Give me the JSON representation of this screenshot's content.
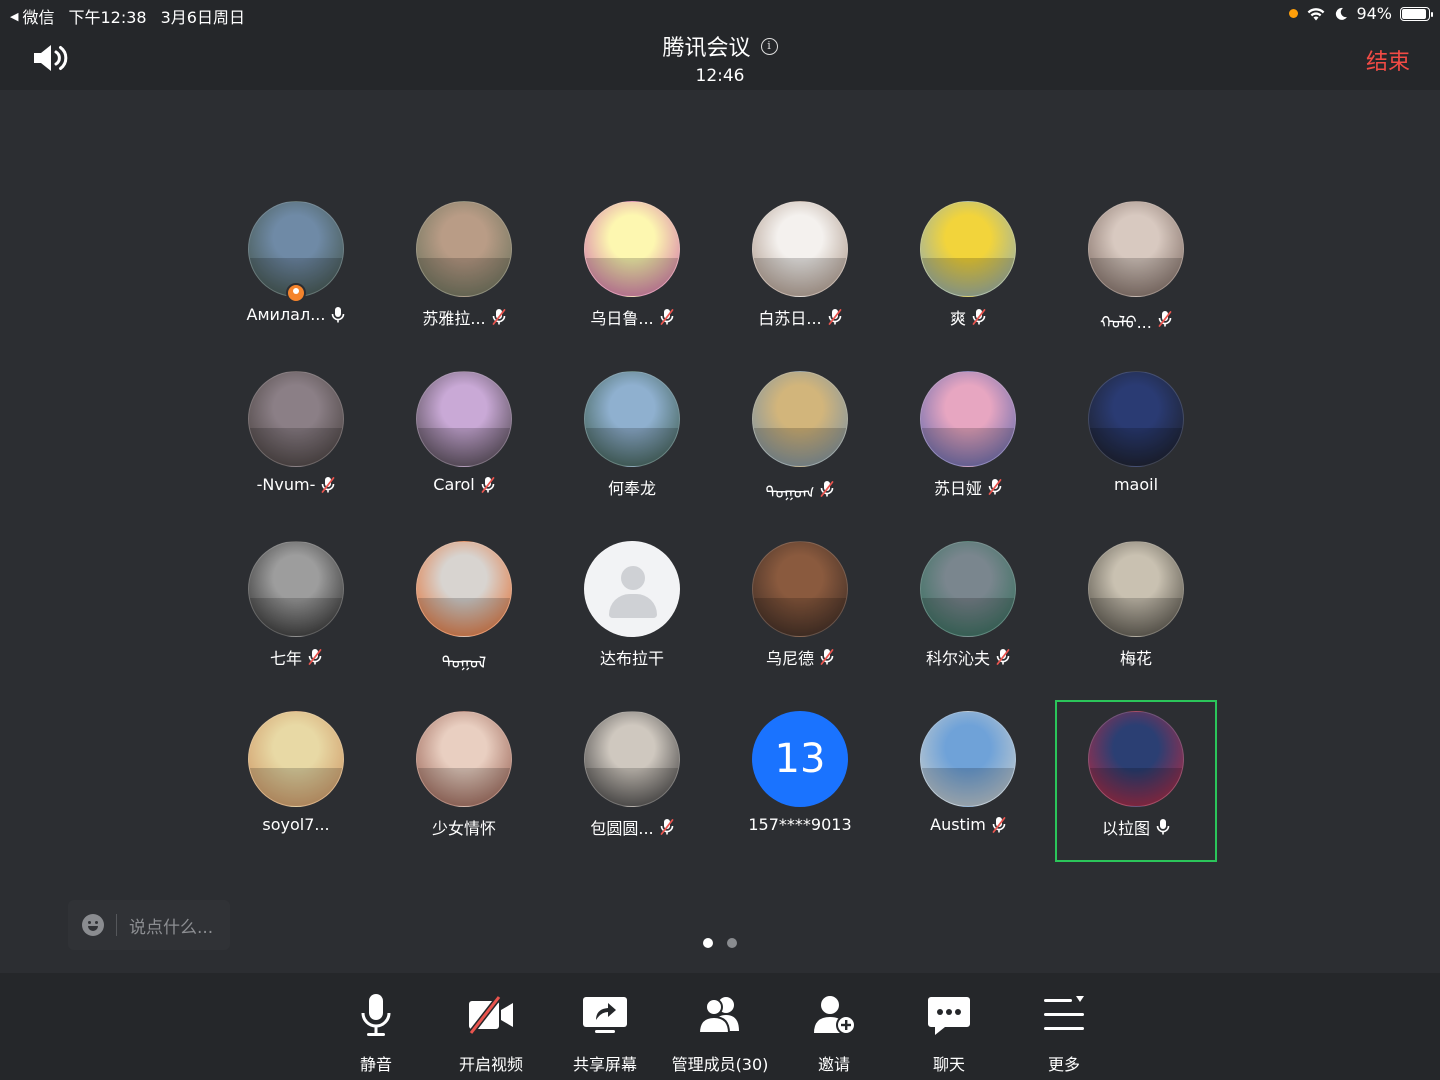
{
  "status_bar": {
    "back_app": "微信",
    "time": "下午12:38",
    "date": "3月6日周日",
    "battery": "94%",
    "battery_level": 0.94
  },
  "header": {
    "title": "腾讯会议",
    "clock": "12:46",
    "end_label": "结束"
  },
  "participants": [
    {
      "name": "Амилал...",
      "mic": "on",
      "host": true,
      "avatar": "photo",
      "colors": [
        "#6f8aa6",
        "#3b4a3a"
      ]
    },
    {
      "name": "苏雅拉...",
      "mic": "muted",
      "avatar": "photo",
      "colors": [
        "#b99c86",
        "#5d6b55"
      ]
    },
    {
      "name": "乌日鲁...",
      "mic": "muted",
      "avatar": "photo",
      "colors": [
        "#fdf7b0",
        "#c95aa8"
      ]
    },
    {
      "name": "白苏日...",
      "mic": "muted",
      "avatar": "photo",
      "colors": [
        "#f4f1ee",
        "#a08878"
      ]
    },
    {
      "name": "爽",
      "mic": "muted",
      "avatar": "photo",
      "colors": [
        "#f2d43b",
        "#7fa6c9"
      ]
    },
    {
      "name": "ᠬᠣᠯᠣ...",
      "mic": "muted",
      "avatar": "photo",
      "colors": [
        "#d8c9c0",
        "#6e5a52"
      ]
    },
    {
      "name": "-Nvum-",
      "mic": "muted",
      "avatar": "photo",
      "colors": [
        "#8b7f86",
        "#3c3532"
      ]
    },
    {
      "name": "Carol",
      "mic": "muted",
      "avatar": "photo",
      "colors": [
        "#c9a9d6",
        "#3a3538"
      ]
    },
    {
      "name": "何奉龙",
      "mic": "none",
      "avatar": "photo",
      "colors": [
        "#8fb0cf",
        "#2f4d39"
      ]
    },
    {
      "name": "ᠲᠣᠭᠣᠭ",
      "mic": "muted",
      "avatar": "photo",
      "colors": [
        "#d2b57b",
        "#6a8bab"
      ]
    },
    {
      "name": "苏日娅",
      "mic": "muted",
      "avatar": "photo",
      "colors": [
        "#e7a6c1",
        "#4a5ea8"
      ]
    },
    {
      "name": "maoil",
      "mic": "none",
      "avatar": "photo",
      "colors": [
        "#2a3b73",
        "#1a1a1a"
      ]
    },
    {
      "name": "七年",
      "mic": "muted",
      "avatar": "photo",
      "colors": [
        "#9d9d9d",
        "#1c1c1c"
      ]
    },
    {
      "name": "ᠲᠣᠭᠣᠯ",
      "mic": "none",
      "avatar": "photo",
      "colors": [
        "#d8d4d0",
        "#e3611d"
      ]
    },
    {
      "name": "达布拉干",
      "mic": "none",
      "avatar": "placeholder"
    },
    {
      "name": "乌尼德",
      "mic": "muted",
      "avatar": "photo",
      "colors": [
        "#8a5a3e",
        "#2e2320"
      ]
    },
    {
      "name": "科尔沁夫",
      "mic": "muted",
      "avatar": "photo",
      "colors": [
        "#7a868e",
        "#2a6b55"
      ]
    },
    {
      "name": "梅花",
      "mic": "none",
      "avatar": "photo",
      "colors": [
        "#c9c1b1",
        "#3d3a33"
      ]
    },
    {
      "name": "soyol7...",
      "mic": "none",
      "avatar": "photo",
      "colors": [
        "#e8d9a5",
        "#c98b5a"
      ]
    },
    {
      "name": "少女情怀",
      "mic": "none",
      "avatar": "photo",
      "colors": [
        "#e9cfc1",
        "#8a4e40"
      ]
    },
    {
      "name": "包圆圆...",
      "mic": "muted",
      "avatar": "photo",
      "colors": [
        "#cfc8bf",
        "#2a2a2c"
      ]
    },
    {
      "name": "157****9013",
      "mic": "none",
      "avatar": "number",
      "number": "13"
    },
    {
      "name": "Austim",
      "mic": "muted",
      "avatar": "photo",
      "colors": [
        "#6fa2d8",
        "#d8d5cc"
      ]
    },
    {
      "name": "以拉图",
      "mic": "on",
      "active": true,
      "avatar": "photo",
      "colors": [
        "#2b3f73",
        "#c9273b"
      ]
    }
  ],
  "chat": {
    "placeholder": "说点什么..."
  },
  "pagination": {
    "current": 1,
    "total": 2
  },
  "toolbar": {
    "mute": "静音",
    "video": "开启视频",
    "share": "共享屏幕",
    "members": "管理成员(30)",
    "invite": "邀请",
    "chat": "聊天",
    "more": "更多"
  },
  "colors": {
    "background": "#2c2e32",
    "bar": "#25272a",
    "end": "#f24b45",
    "active_speaker": "#2bc55a",
    "muted": "#e9544e",
    "number_avatar": "#1a73ff"
  }
}
